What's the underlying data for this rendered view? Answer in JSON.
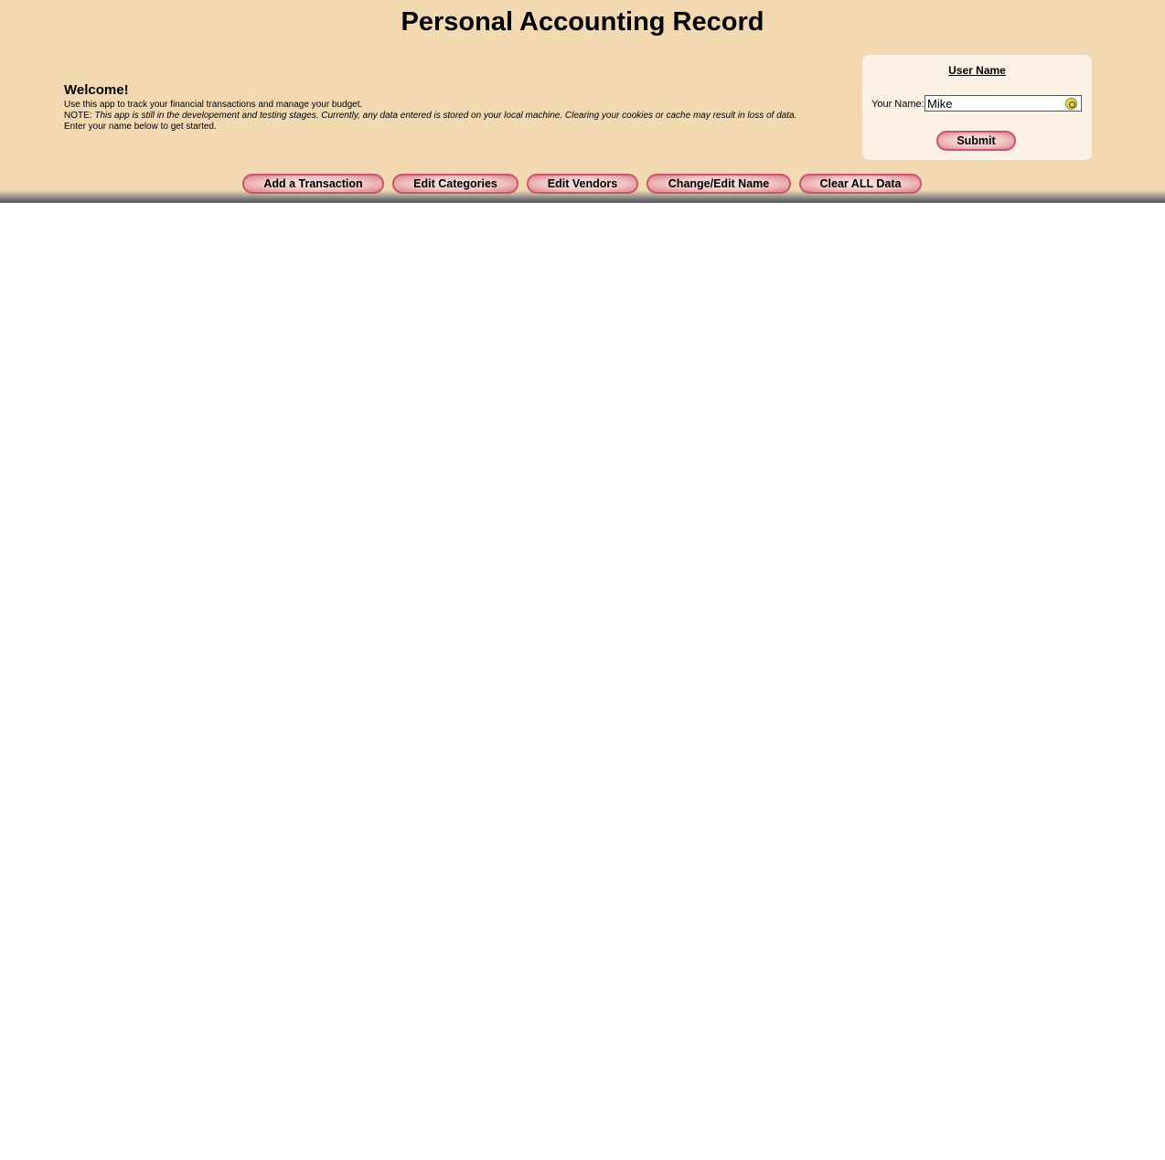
{
  "app": {
    "title": "Personal Accounting Record"
  },
  "welcome": {
    "heading": "Welcome!",
    "line1": "Use this app to track your financial transactions and manage your budget.",
    "note_prefix": "NOTE: ",
    "note_text": "This app is still in the developement and testing stages. Currently, any data entered is stored on your local machine. Clearing your cookies or cache may result in loss of data.",
    "line3": "Enter your name below to get started."
  },
  "user_card": {
    "title": "User Name",
    "name_label": "Your Name:",
    "name_value": "Mike",
    "submit_label": "Submit",
    "autofill_icon": "autofill-key-icon"
  },
  "nav": {
    "buttons": [
      {
        "label": "Add a Transaction"
      },
      {
        "label": "Edit Categories"
      },
      {
        "label": "Edit Vendors"
      },
      {
        "label": "Change/Edit Name"
      },
      {
        "label": "Clear ALL Data"
      }
    ]
  },
  "colors": {
    "header_bg": "#f2d9b2",
    "card_bg": "#faf0e4",
    "button_border": "#c8566c",
    "button_fill": "#f1c4c2"
  }
}
